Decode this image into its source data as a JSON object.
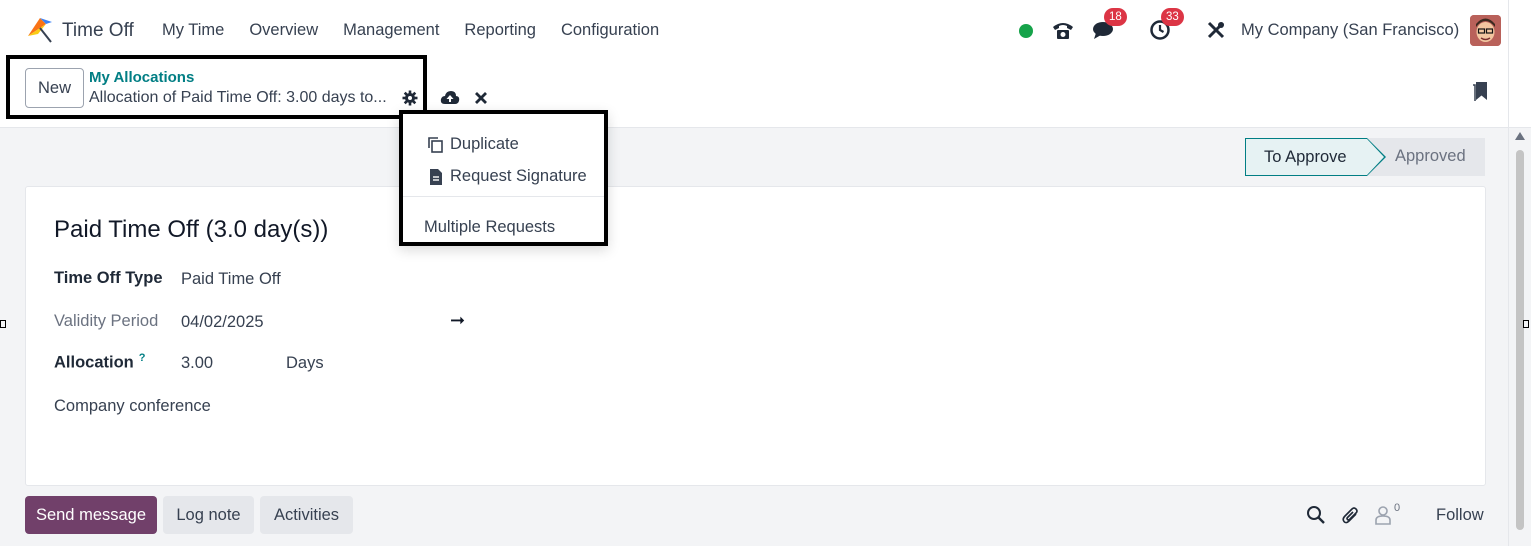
{
  "navbar": {
    "app_name": "Time Off",
    "menu": [
      "My Time",
      "Overview",
      "Management",
      "Reporting",
      "Configuration"
    ],
    "messages_count": "18",
    "activities_count": "33",
    "company": "My Company (San Francisco)"
  },
  "control_panel": {
    "new_label": "New",
    "breadcrumb": "My Allocations",
    "record_name": "Allocation of Paid Time Off: 3.00 days to..."
  },
  "gear_menu": {
    "items": [
      "Duplicate",
      "Request Signature"
    ],
    "extra": "Multiple Requests"
  },
  "status": {
    "stages": [
      "To Approve",
      "Approved"
    ],
    "current": "To Approve"
  },
  "form": {
    "title": "Paid Time Off (3.0 day(s))",
    "time_off_type_label": "Time Off Type",
    "time_off_type_value": "Paid Time Off",
    "validity_label": "Validity Period",
    "validity_start": "04/02/2025",
    "validity_arrow": "➞",
    "allocation_label": "Allocation",
    "allocation_help": "?",
    "allocation_value": "3.00",
    "allocation_unit": "Days",
    "reason": "Company conference"
  },
  "chatter": {
    "send_message": "Send message",
    "log_note": "Log note",
    "activities": "Activities",
    "followers_count": "0",
    "follow": "Follow"
  },
  "colors": {
    "brand_teal": "#017e84",
    "send_button": "#71406a",
    "badge_red": "#dc3545",
    "presence_green": "#16a34a"
  },
  "icons": [
    "time-off-logo-icon",
    "phone-icon",
    "chat-icon",
    "clock-icon",
    "tools-icon",
    "gear-icon",
    "cloud-upload-icon",
    "close-icon",
    "bookmark-icon",
    "copy-icon",
    "document-icon",
    "search-icon",
    "paperclip-icon",
    "user-icon"
  ]
}
